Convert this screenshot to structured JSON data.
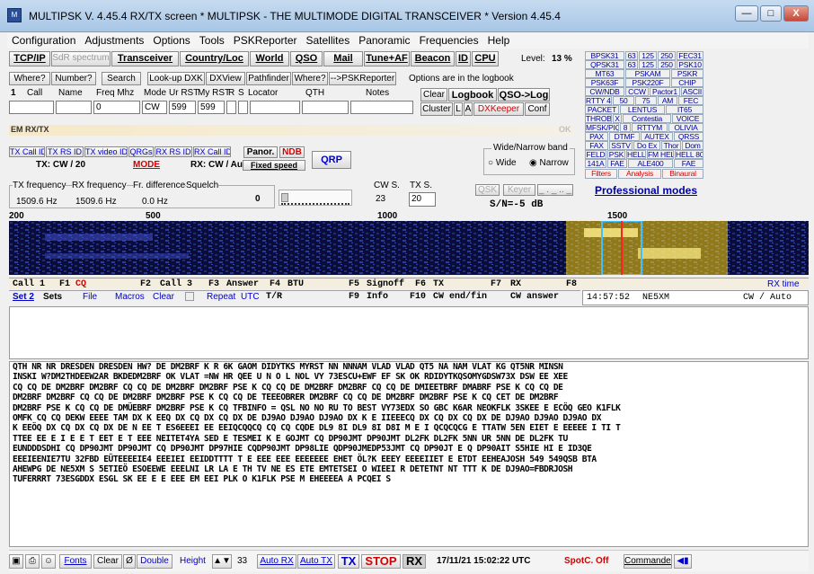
{
  "window": {
    "title": "MULTIPSK V. 4.45.4     RX/TX screen  * MULTIPSK - THE MULTIMODE DIGITAL TRANSCEIVER *   Version 4.45.4",
    "minimize": "—",
    "maximize": "□",
    "close": "X"
  },
  "menu": [
    "Configuration",
    "Adjustments",
    "Options",
    "Tools",
    "PSKReporter",
    "Satellites",
    "Panoramic",
    "Frequencies",
    "Help"
  ],
  "toolbar": {
    "tcpip": "TCP/IP",
    "sdr": "SdR spectrum",
    "transceiver": "Transceiver",
    "country": "Country/Loc",
    "world": "World",
    "qso": "QSO",
    "mail": "Mail",
    "tune": "Tune+AF",
    "beacon": "Beacon",
    "id": "ID",
    "cpu": "CPU",
    "level_label": "Level:",
    "level_value": "13 %"
  },
  "lookup": {
    "where": "Where?",
    "number": "Number?",
    "search": "Search",
    "lookup_dxk": "Look-up DXK",
    "dxview": "DXView",
    "pathfinder": "Pathfinder",
    "where2": "Where?",
    "pskreporter": "-->PSKReporter",
    "options_note": "Options are in the logbook"
  },
  "qso_fields": {
    "index": "1",
    "call_label": "Call",
    "name_label": "Name",
    "freq_label": "Freq Mhz",
    "mode_label": "Mode",
    "ur_rst_label": "Ur RST",
    "my_rst_label": "My RST",
    "r_label": "R",
    "s_label": "S",
    "locator_label": "Locator",
    "qth_label": "QTH",
    "notes_label": "Notes",
    "freq_value": "0",
    "mode_value": "CW",
    "ur_rst_value": "599",
    "my_rst_value": "599",
    "clear": "Clear",
    "logbook": "Logbook",
    "qso_log": "QSO->Log",
    "cluster": "Cluster",
    "l": "L",
    "a": "A",
    "dxkeeper": "DXKeeper",
    "conf": "Conf"
  },
  "em_rxtx": "EM RX/TX",
  "ok_label": "OK",
  "mode_row": {
    "tx_callid": "TX Call ID",
    "tx_rsid": "TX RS ID",
    "tx_video": "TX video ID",
    "qrgs": "QRGs",
    "rx_rsid": "RX RS ID",
    "rx_callid": "RX Call ID",
    "panor": "Panor.",
    "ndb": "NDB",
    "qrp": "QRP",
    "tx_mode": "TX: CW / 20",
    "mode": "MODE",
    "rx_mode": "RX: CW / Auto",
    "fixed_speed": "Fixed speed",
    "wide_narrow_title": "Wide/Narrow band",
    "wide": "Wide",
    "narrow": "Narrow"
  },
  "freq_row": {
    "tx_freq_label": "TX frequency",
    "rx_freq_label": "RX frequency",
    "diff_label": "Fr. difference",
    "squelch_label": "Squelch",
    "tx_freq": "1509.6 Hz",
    "rx_freq": "1509.6 Hz",
    "diff": "0.0 Hz",
    "squelch": "0",
    "cw_s_label": "CW S.",
    "cw_s_value": "23",
    "tx_s_label": "TX S.",
    "tx_s_value": "20",
    "qsk": "QSK",
    "keyer": "Keyer",
    "dashes": "_ . _ .. _",
    "sn": "S/N=-5  dB"
  },
  "modes": [
    "BPSK31",
    "63",
    "125",
    "250",
    "FEC31",
    "QPSK31",
    "63",
    "125",
    "250",
    "PSK10",
    "MT63",
    "PSKAM",
    "PSKR",
    "PSK63F",
    "PSK220F",
    "CHIP",
    "CW/NDB",
    "CCW",
    "Pactor1",
    "ASCII",
    "RTTY 45",
    "50",
    "75",
    "AM",
    "FEC",
    "PACKET",
    "LENTUS",
    "IT65",
    "THROB",
    "X",
    "Contestia",
    "VOICE",
    "MFSK/PIQ",
    "8",
    "RTTYM",
    "OLIVIA",
    "PAX",
    "DTMF",
    "AUTEX",
    "QRSS",
    "FAX",
    "SSTV",
    "Do Ex",
    "Thor",
    "Dom",
    "FELD",
    "PSK",
    "HELL",
    "FM HELL",
    "HELL 80",
    "141A",
    "FAE",
    "ALE400",
    "FAE",
    "Filters",
    "Analysis",
    "Binaural"
  ],
  "professional": "Professional modes",
  "scale": [
    "200",
    "500",
    "1000",
    "1500"
  ],
  "macros1": [
    "Call 1",
    "F1",
    "CQ",
    "F2",
    "Call 3",
    "F3",
    "Answer",
    "F4",
    "BTU",
    "F5",
    "Signoff",
    "F6",
    "TX",
    "F7",
    "RX",
    "F8",
    "RX time"
  ],
  "macros2": [
    "Set 2",
    "Sets",
    "File",
    "Macros",
    "Clear",
    "Repeat",
    "UTC",
    "T/R",
    "F9",
    "Info",
    "F10",
    "CW end/fin",
    "CW answer"
  ],
  "rx_time": {
    "time": "14:57:52",
    "call": "NE5XM",
    "mode": "CW / Auto"
  },
  "rx_text": [
    "QTH NR NR DRESDEN DRESDEN HW? DE DM2BRF K R 6K GAOM DIDYTKS MYRST NN NNNAM VLAD VLAD QT5 NA NAM VLAT KG QT5NR MINSN",
    "INSKI W?DM2THDEEW2AR BKDEDM2BRF OK VLAT =NW HR QEE U N O L NOL VY 73ESCU+EWF EF SK  OK RDIDYTKQSOMYGDSW73X DSW EE XEE",
    "CQ CQ DE DM2BRF DM2BRF CQ CQ DE DM2BRF DM2BRF PSE K CQ CQ DE DM2BRF DM2BRF CQ CQ DE DMIEETBRF DMABRF PSE K CQ CQ DE",
    "DM2BRF DM2BRF CQ CQ DE DM2BRF DM2BRF PSE K CQ CQ DE TEEEOBRER DM2BRF CQ CQ DE DM2BRF DM2BRF PSE K CQ CET DE DM2BRF",
    "DM2BRF PSE K CQ CQ DE DMÜEBRF DM2BRF PSE K CQ TFBINFO = QSL NO NO RU TO BEST VY73EDX SO GBC K6AR NEOKFLK 3SKEE E ECÖQ GEO K1FLK",
    "OMFK CQ CQ DEKW EEEE TAM DX K EEQ DX CQ DX CQ DX DE DJ9AO DJ9AO DJ9AO DX K E IIEEECQ DX CQ DX CQ DX DE DJ9AO DJ9AO DJ9AO DX",
    "K EEÖQ DX CQ DX CQ DX DE N EE T ES6EEEI EE EEIQCQQCQ CQ CQ CQDE DL9 8I DL9 8I D8I M E I QCQCQCG E TTATW 5EN EIET E EEEEE I TI T",
    "TTEE EE E I E E T EET E T EEE NEITET4YA SED E TESMEI K E GOJMT CQ DP90JMT DP90JMT DL2FK DL2FK 5NN UR 5NN DE DL2FK TU",
    "EUNDDDSDHI CQ DP90JMT DP90JMT CQ DP90JMT DP97HIE CQDP90JMT DP98LIE QDP90JMEDP53JMT CQ DP90JT E Q DP90AIT S5HIE HI E ID3QE",
    "EEEIEENIE7TU 32FBD EÜTEEEEIE4 EEEIEI EEIDDTTTT T E EEE EEE EEEEEEE EHET ÖL?K EEEY EEEEIIET E ETDT EEHEAJOSH 549 549QSB BTA",
    "AHEWPG DE NE5XM S 5ETIEÖ ESOEEWE EEELNI LR LA E TH TV NE ES ETE EMTETSEI O WIEEI R DETETNT NT TTT K DE DJ9AO=FBDRJOSH",
    "TUFERRRT 73ESGDDX ESGL  SK  EE E E EEE EM EEI PLK O K1FLK PSE M EHEEEEA A PCQEI S"
  ],
  "status": {
    "fonts": "Fonts",
    "clear": "Clear",
    "zero": "Ø",
    "double": "Double",
    "height": "Height",
    "height_value": "33",
    "auto_rx": "Auto RX",
    "auto_tx": "Auto TX",
    "tx": "TX",
    "stop": "STOP",
    "rx": "RX",
    "datetime": "17/11/21 15:02:22 UTC",
    "spotc": "SpotC. Off",
    "commander": "Commander"
  },
  "colors": {
    "accent_red": "#d40000",
    "waterfall_bg": "#0a0d3a",
    "signal": "#ffd400",
    "cursor": "#ff2020"
  }
}
